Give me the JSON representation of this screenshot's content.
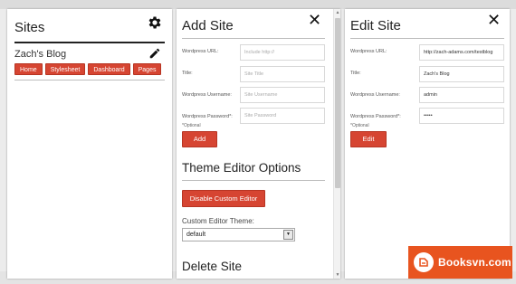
{
  "sites_panel": {
    "title": "Sites",
    "site": {
      "name": "Zach's Blog",
      "buttons": [
        "Home",
        "Stylesheet",
        "Dashboard",
        "Pages"
      ]
    }
  },
  "add_site_panel": {
    "title": "Add Site",
    "fields": [
      {
        "label": "Wordpress URL:",
        "placeholder": "Include http://"
      },
      {
        "label": "Title:",
        "placeholder": "Site Title"
      },
      {
        "label": "Wordpress Username:",
        "placeholder": "Site Username"
      },
      {
        "label": "Wordpress Password*:",
        "placeholder": "Site Password"
      }
    ],
    "optional_note": "*Optional",
    "submit_label": "Add",
    "theme_editor": {
      "title": "Theme Editor Options",
      "disable_button": "Disable Custom Editor",
      "theme_label": "Custom Editor Theme:",
      "theme_value": "default"
    },
    "delete_title": "Delete Site"
  },
  "edit_site_panel": {
    "title": "Edit Site",
    "fields": [
      {
        "label": "Wordpress URL:",
        "value": "http://zach-adams.com/testblog"
      },
      {
        "label": "Title:",
        "value": "Zach's Blog"
      },
      {
        "label": "Wordpress Username:",
        "value": "admin"
      },
      {
        "label": "Wordpress Password*:",
        "value": "•••••"
      }
    ],
    "optional_note": "*Optional",
    "submit_label": "Edit"
  },
  "watermark": {
    "text": "Booksvn.com"
  },
  "colors": {
    "accent": "#d64532",
    "watermark": "#e8541f"
  },
  "icons": [
    "gear-icon",
    "pencil-icon",
    "close-icon",
    "chevron-down-icon"
  ]
}
